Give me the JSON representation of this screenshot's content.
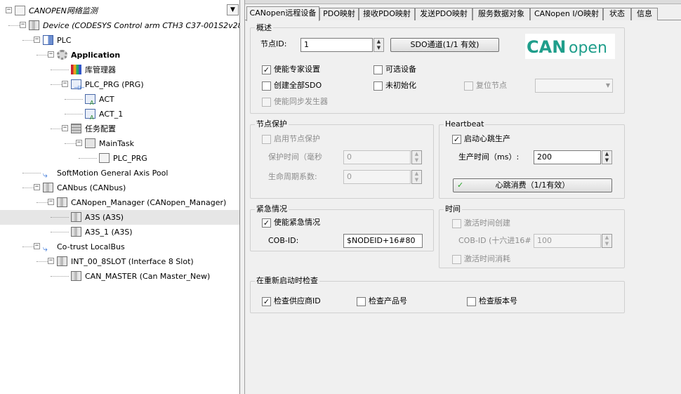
{
  "tree": {
    "items": [
      {
        "label": "CANOPEN网络监测",
        "style": "ital",
        "icon": "project-icon",
        "expander": "−"
      },
      {
        "label": "Device (CODESYS Control arm CTH3 C37-001S2v28)",
        "style": "ital",
        "icon": "device-icon",
        "expander": "−"
      },
      {
        "label": "PLC",
        "style": "",
        "icon": "plc-icon",
        "expander": "−"
      },
      {
        "label": "Application",
        "style": "bold",
        "icon": "application-gear-icon",
        "expander": "−"
      },
      {
        "label": "库管理器",
        "style": "",
        "icon": "library-manager-icon",
        "expander": ""
      },
      {
        "label": "PLC_PRG (PRG)",
        "style": "",
        "icon": "program-icon",
        "expander": "−"
      },
      {
        "label": "ACT",
        "style": "",
        "icon": "action-icon",
        "expander": ""
      },
      {
        "label": "ACT_1",
        "style": "",
        "icon": "action-icon",
        "expander": ""
      },
      {
        "label": "任务配置",
        "style": "",
        "icon": "task-config-icon",
        "expander": "−"
      },
      {
        "label": "MainTask",
        "style": "",
        "icon": "task-icon",
        "expander": "−"
      },
      {
        "label": "PLC_PRG",
        "style": "",
        "icon": "program-call-icon",
        "expander": ""
      },
      {
        "label": "SoftMotion General Axis Pool",
        "style": "",
        "icon": "axis-pool-icon",
        "expander": ""
      },
      {
        "label": "CANbus (CANbus)",
        "style": "",
        "icon": "device-icon",
        "expander": "−"
      },
      {
        "label": "CANopen_Manager (CANopen_Manager)",
        "style": "",
        "icon": "device-icon",
        "expander": "−"
      },
      {
        "label": "A3S (A3S)",
        "style": "",
        "icon": "device-icon",
        "expander": ""
      },
      {
        "label": "A3S_1 (A3S)",
        "style": "",
        "icon": "device-icon",
        "expander": ""
      },
      {
        "label": "Co-trust LocalBus",
        "style": "",
        "icon": "axis-pool-icon",
        "expander": "−"
      },
      {
        "label": "INT_00_8SLOT (Interface 8 Slot)",
        "style": "",
        "icon": "device-icon",
        "expander": "−"
      },
      {
        "label": "CAN_MASTER (Can Master_New)",
        "style": "",
        "icon": "device-icon",
        "expander": ""
      }
    ],
    "dropdown_glyph": "▼"
  },
  "tabs": [
    "CANopen远程设备",
    "PDO映射",
    "接收PDO映射",
    "发送PDO映射",
    "服务数据对象",
    "CANopen I/O映射",
    "状态",
    "信息"
  ],
  "overview": {
    "title": "概述",
    "node_id_label": "节点ID:",
    "node_id_value": "1",
    "sdo_button": "SDO通道(1/1 有效)",
    "expert_settings": "使能专家设置",
    "optional_device": "可选设备",
    "create_all_sdo": "创建全部SDO",
    "no_init": "未初始化",
    "reset_node": "复位节点",
    "enable_sync": "使能同步发生器",
    "logo_text_1": "CAN",
    "logo_text_2": "open"
  },
  "node_guard": {
    "title": "节点保护",
    "enable": "启用节点保护",
    "guard_time_label": "保护时间（毫秒",
    "guard_time_value": "0",
    "life_factor_label": "生命周期系数:",
    "life_factor_value": "0"
  },
  "heartbeat": {
    "title": "Heartbeat",
    "enable_producer": "启动心跳生产",
    "producer_time_label": "生产时间（ms）:",
    "producer_time_value": "200",
    "consumer_button": "心跳消费（1/1有效）",
    "consumer_check": "✓"
  },
  "emergency": {
    "title": "紧急情况",
    "enable": "使能紧急情况",
    "cob_label": "COB-ID:",
    "cob_value": "$NODEID+16#80"
  },
  "time": {
    "title": "时间",
    "enable_create": "激活时间创建",
    "cob_label": "COB-ID (十六进16#",
    "cob_value": "100",
    "enable_consume": "激活时间消耗"
  },
  "check": {
    "title": "在重新启动时检查",
    "vendor": "检查供应商ID",
    "product": "检查产品号",
    "revision": "检查版本号"
  },
  "checked": {
    "expert_settings": true,
    "optional_device": false,
    "create_all_sdo": false,
    "no_init": false,
    "reset_node": false,
    "enable_sync": false,
    "node_guard": false,
    "heartbeat": true,
    "emergency": true,
    "time_create": false,
    "time_consume": false,
    "vendor": true,
    "product": false,
    "revision": false
  },
  "colors": {
    "logo_teal": "#1f9e8b",
    "check_green": "#21a121"
  }
}
